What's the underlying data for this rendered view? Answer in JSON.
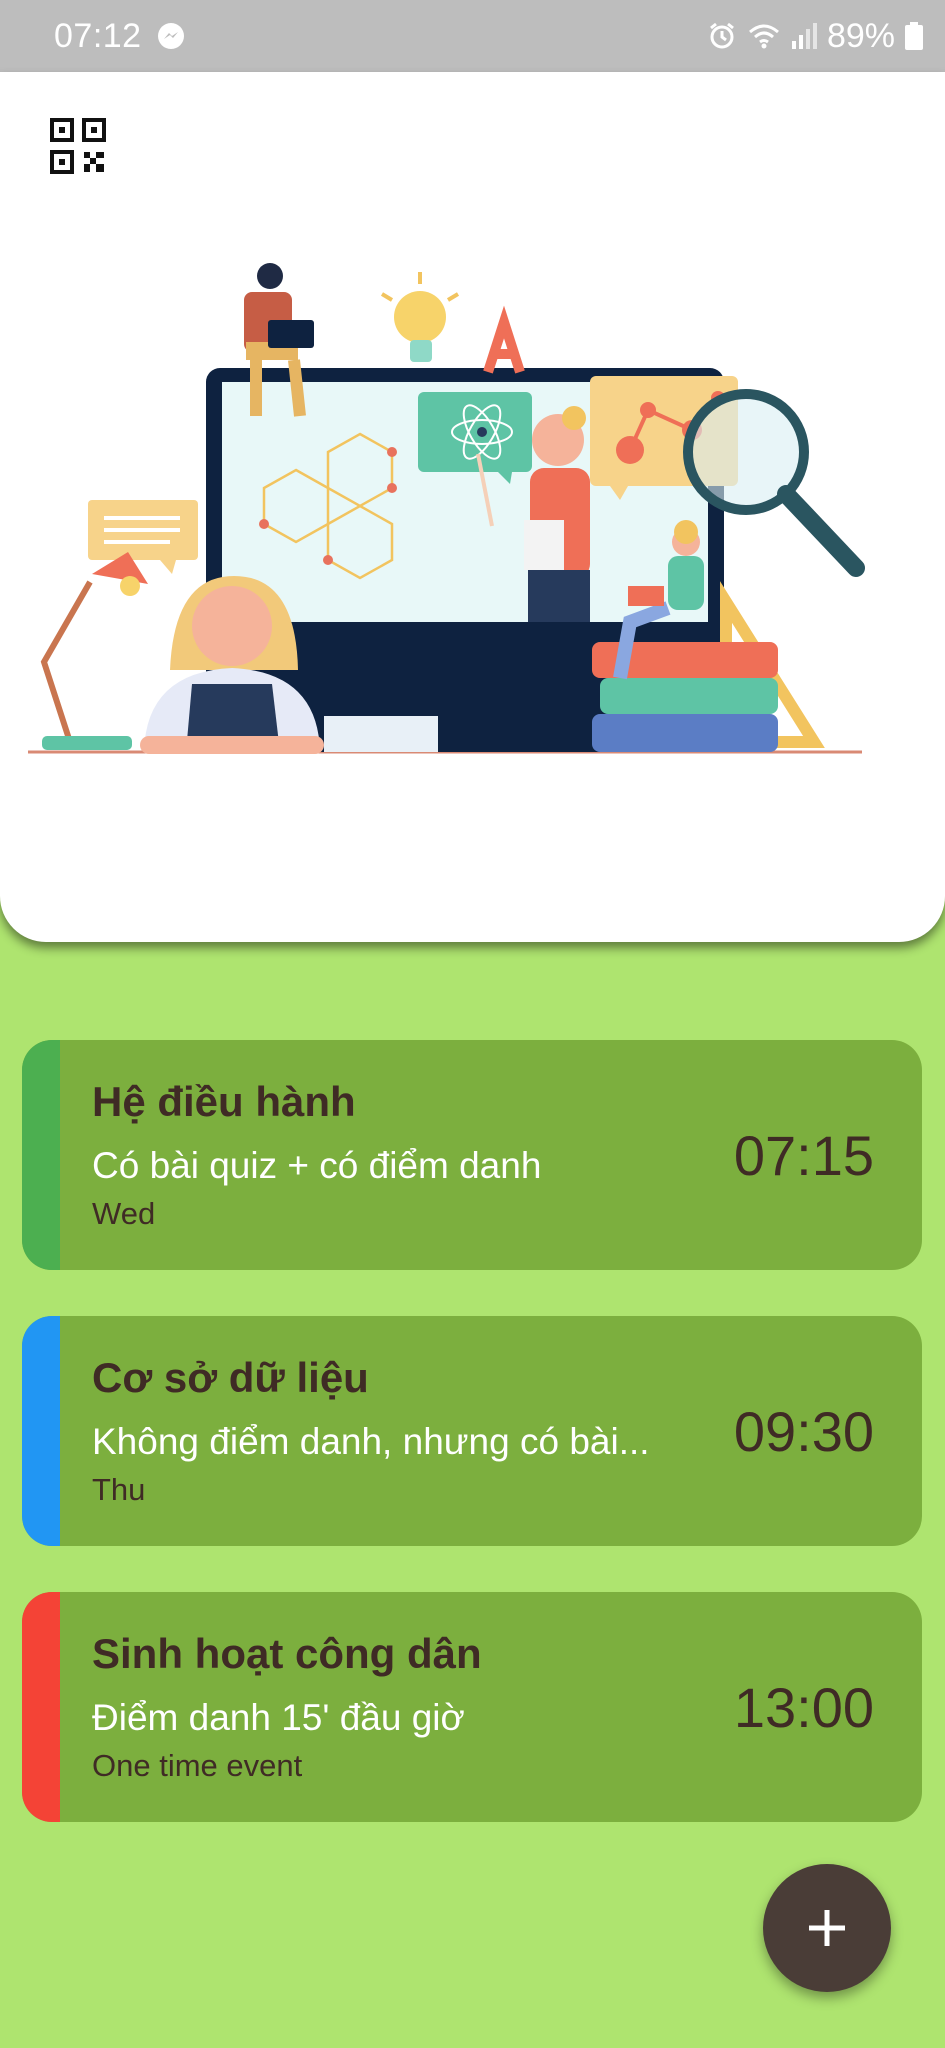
{
  "status_bar": {
    "time": "07:12",
    "battery": "89%",
    "icons": [
      "messenger-icon",
      "alarm-icon",
      "wifi-icon",
      "signal-icon",
      "battery-icon"
    ]
  },
  "header": {
    "qr_icon": "qr-code-icon",
    "illustration": "education-illustration"
  },
  "events": [
    {
      "title": "Hệ điều hành",
      "note": "Có bài quiz + có điểm danh",
      "day": "Wed",
      "time": "07:15",
      "color": "#4caf50"
    },
    {
      "title": "Cơ sở dữ liệu",
      "note": "Không điểm danh, nhưng có bài...",
      "day": "Thu",
      "time": "09:30",
      "color": "#2196f3"
    },
    {
      "title": "Sinh hoạt công dân",
      "note": "Điểm danh 15' đầu giờ",
      "day": "One time event",
      "time": "13:00",
      "color": "#f44336"
    }
  ],
  "fab": {
    "icon": "plus-icon"
  },
  "colors": {
    "background": "#aee46f",
    "card": "#7caf3e",
    "title_text": "#3f2b25",
    "fab": "#4a3d37"
  }
}
